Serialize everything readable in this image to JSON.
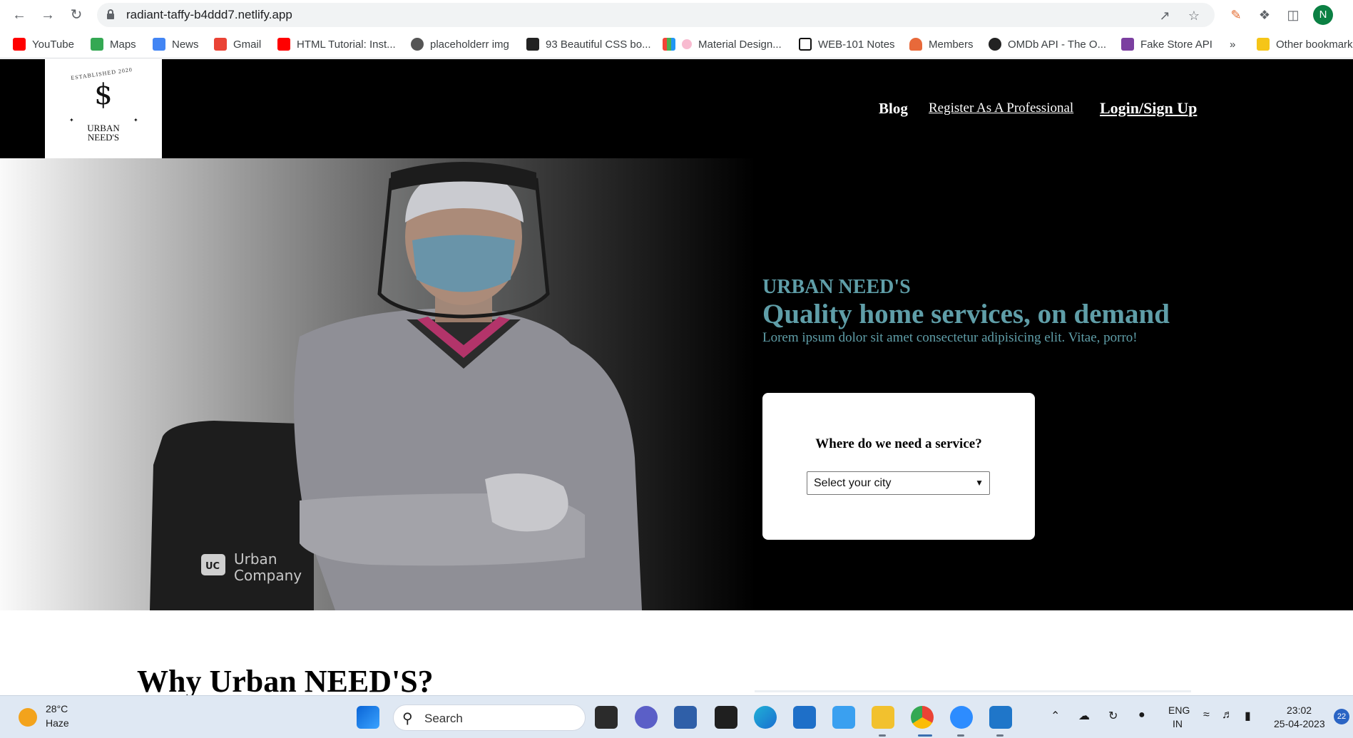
{
  "browser": {
    "url": "radiant-taffy-b4ddd7.netlify.app",
    "nav_icons": [
      "back-icon",
      "forward-icon",
      "reload-icon"
    ],
    "profile_initial": "N",
    "bookmarks": [
      {
        "label": "YouTube",
        "color": "#ff0000"
      },
      {
        "label": "Maps",
        "color": "#34a853"
      },
      {
        "label": "News",
        "color": "#4285f4"
      },
      {
        "label": "Gmail",
        "color": "#ea4335"
      },
      {
        "label": "HTML Tutorial: Inst...",
        "color": "#ff0000"
      },
      {
        "label": "placeholderr img",
        "color": "#555555"
      },
      {
        "label": "93 Beautiful CSS bo...",
        "color": "#222222"
      },
      {
        "label": "Material Design...",
        "color": "#e91e63"
      },
      {
        "label": "WEB-101 Notes",
        "color": "#111111"
      },
      {
        "label": "Members",
        "color": "#e8693a"
      },
      {
        "label": "OMDb API - The O...",
        "color": "#222222"
      },
      {
        "label": "Fake Store API",
        "color": "#7b3fa0"
      }
    ],
    "overflow": "»",
    "other_bookmarks": "Other bookmarks"
  },
  "site": {
    "logo": {
      "arc_text": "ESTABLISHED 2020",
      "mark": "$",
      "line1": "URBAN",
      "line2": "NEED'S"
    },
    "nav": {
      "blog": "Blog",
      "register": "Register As A Professional",
      "login": "Login/Sign Up"
    },
    "hero": {
      "brand": "URBAN NEED'S",
      "tagline": "Quality home services, on demand",
      "description": "Lorem ipsum dolor sit amet consectetur adipisicing elit. Vitae, porro!",
      "accent_color": "#5f9ea8",
      "card": {
        "question": "Where do we need a service?",
        "select_value": "Select your city"
      }
    },
    "why_title": "Why Urban NEED'S?"
  },
  "taskbar": {
    "weather_temp": "28°C",
    "weather_cond": "Haze",
    "search_label": "Search",
    "lang_top": "ENG",
    "lang_bottom": "IN",
    "time": "23:02",
    "date": "25-04-2023",
    "notifications": "22"
  }
}
